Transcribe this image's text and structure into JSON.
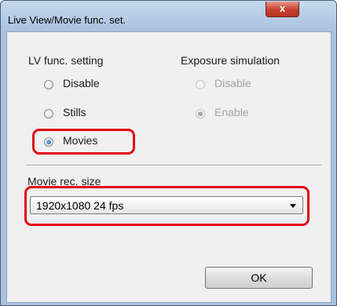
{
  "window": {
    "title": "Live View/Movie func. set.",
    "close_label": "x"
  },
  "lv_func": {
    "heading": "LV func. setting",
    "options": [
      "Disable",
      "Stills",
      "Movies"
    ],
    "selected": "Movies"
  },
  "exposure_sim": {
    "heading": "Exposure simulation",
    "options": [
      "Disable",
      "Enable"
    ],
    "selected": "Enable",
    "enabled": false
  },
  "movie_rec": {
    "label": "Movie rec. size",
    "value": "1920x1080  24 fps"
  },
  "buttons": {
    "ok_label": "OK"
  },
  "colors": {
    "highlight": "#e20613",
    "titlebar": "#b8cde6",
    "close_button": "#c8402c"
  }
}
